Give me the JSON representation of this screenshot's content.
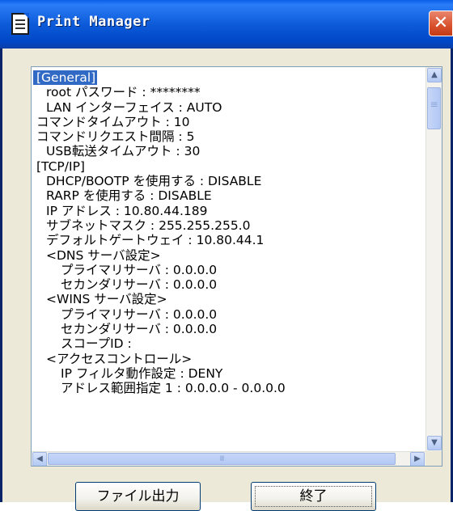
{
  "window": {
    "title": "Print Manager",
    "close_glyph": "✕"
  },
  "listbox": {
    "lines": [
      {
        "indent": 0,
        "text": "[General]",
        "selected": true
      },
      {
        "indent": 1,
        "text": "root パスワード : ********"
      },
      {
        "indent": 1,
        "text": "LAN インターフェイス : AUTO"
      },
      {
        "indent": 0,
        "text": "コマンドタイムアウト : 10"
      },
      {
        "indent": 0,
        "text": "コマンドリクエスト間隔 : 5"
      },
      {
        "indent": 1,
        "text": "USB転送タイムアウト : 30"
      },
      {
        "indent": 0,
        "text": "[TCP/IP]"
      },
      {
        "indent": 1,
        "text": "DHCP/BOOTP を使用する : DISABLE"
      },
      {
        "indent": 1,
        "text": "RARP を使用する : DISABLE"
      },
      {
        "indent": 1,
        "text": "IP アドレス : 10.80.44.189"
      },
      {
        "indent": 1,
        "text": "サブネットマスク : 255.255.255.0"
      },
      {
        "indent": 1,
        "text": "デフォルトゲートウェイ : 10.80.44.1"
      },
      {
        "indent": 1,
        "text": "<DNS サーバ設定>"
      },
      {
        "indent": 2,
        "text": "プライマリサーバ : 0.0.0.0"
      },
      {
        "indent": 2,
        "text": "セカンダリサーバ : 0.0.0.0"
      },
      {
        "indent": 1,
        "text": "<WINS サーバ設定>"
      },
      {
        "indent": 2,
        "text": "プライマリサーバ : 0.0.0.0"
      },
      {
        "indent": 2,
        "text": "セカンダリサーバ : 0.0.0.0"
      },
      {
        "indent": 2,
        "text": "スコープID :"
      },
      {
        "indent": 1,
        "text": "<アクセスコントロール>"
      },
      {
        "indent": 2,
        "text": "IP フィルタ動作設定 : DENY"
      },
      {
        "indent": 2,
        "text": "アドレス範囲指定 1 : 0.0.0.0 - 0.0.0.0"
      }
    ]
  },
  "scrollbars": {
    "up": "▲",
    "down": "▼",
    "left": "◀",
    "right": "▶"
  },
  "buttons": {
    "export_label": "ファイル出力",
    "exit_label": "終了"
  }
}
